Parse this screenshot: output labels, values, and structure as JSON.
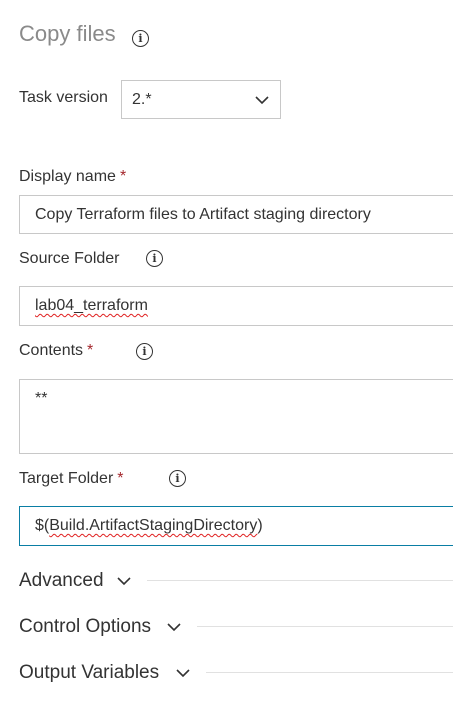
{
  "panel": {
    "title": "Copy files"
  },
  "task_version": {
    "label": "Task version",
    "value": "2.*"
  },
  "display_name": {
    "label": "Display name",
    "required_mark": "*",
    "value": "Copy  Terraform files to Artifact staging directory"
  },
  "source_folder": {
    "label": "Source Folder",
    "value": "lab04_terraform"
  },
  "contents": {
    "label": "Contents",
    "required_mark": "*",
    "value": "**"
  },
  "target_folder": {
    "label": "Target Folder",
    "required_mark": "*",
    "value_prefix": "$(",
    "value_main": "Build.ArtifactStagingDirectory",
    "value_suffix": ")"
  },
  "sections": {
    "advanced": "Advanced",
    "control_options": "Control Options",
    "output_variables": "Output Variables"
  },
  "colors": {
    "required": "#a4262c",
    "focus_border": "#0a7ea4",
    "spellcheck": "#e02020"
  }
}
